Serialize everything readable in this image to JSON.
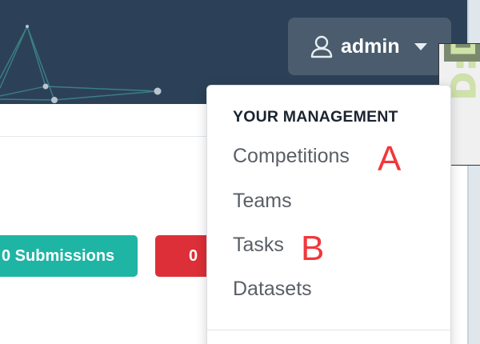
{
  "header": {
    "user_menu": {
      "icon": "user-icon",
      "label": "admin",
      "caret_icon": "caret-down-icon"
    }
  },
  "content": {
    "submissions_badge": "0 Submissions",
    "red_badge": "0"
  },
  "dropdown": {
    "section_header": "YOUR MANAGEMENT",
    "items": [
      {
        "label": "Competitions"
      },
      {
        "label": "Teams"
      },
      {
        "label": "Tasks"
      },
      {
        "label": "Datasets"
      }
    ]
  },
  "annotations": {
    "a": "A",
    "b": "B"
  },
  "colors": {
    "header_bg": "#2c4157",
    "user_button_bg": "#4a5c6e",
    "teal": "#1fb5a5",
    "red": "#dc2f37",
    "annotation": "#f2373b"
  }
}
